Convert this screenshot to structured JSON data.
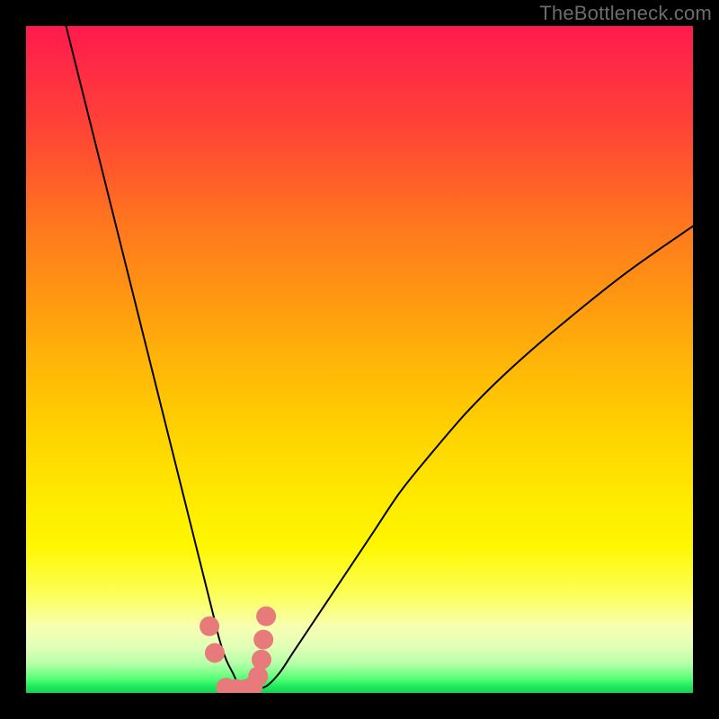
{
  "watermark": "TheBottleneck.com",
  "chart_data": {
    "type": "line",
    "title": "",
    "xlabel": "",
    "ylabel": "",
    "xlim": [
      0,
      100
    ],
    "ylim": [
      0,
      100
    ],
    "grid": false,
    "legend": false,
    "background_gradient": {
      "top_color": "#ff1a4d",
      "mid_color": "#ffd000",
      "bottom_color": "#0fd452"
    },
    "series": [
      {
        "name": "bottleneck-curve",
        "color": "#000000",
        "stroke_width": 2,
        "x": [
          6,
          8,
          10,
          12,
          14,
          16,
          18,
          20,
          22,
          24,
          26,
          28,
          29,
          30,
          31,
          32,
          33,
          34,
          36,
          38,
          40,
          44,
          48,
          52,
          56,
          60,
          66,
          72,
          80,
          90,
          100
        ],
        "y": [
          100,
          92,
          84,
          76,
          68,
          60,
          52,
          44,
          36,
          28,
          20,
          12,
          8,
          5,
          3,
          1,
          0.5,
          0.5,
          1,
          3,
          6,
          12,
          18,
          24,
          30,
          35,
          42,
          48,
          55,
          63,
          70
        ]
      },
      {
        "name": "highlight-dots",
        "color": "#e77b7b",
        "type": "scatter",
        "marker_size": 11,
        "x": [
          27.5,
          28.3,
          30.0,
          31.5,
          33.0,
          34.0,
          34.8,
          35.3,
          35.6,
          36.0
        ],
        "y": [
          10.0,
          6.0,
          0.8,
          0.6,
          0.6,
          1.0,
          2.5,
          5.0,
          8.0,
          11.5
        ]
      }
    ]
  }
}
